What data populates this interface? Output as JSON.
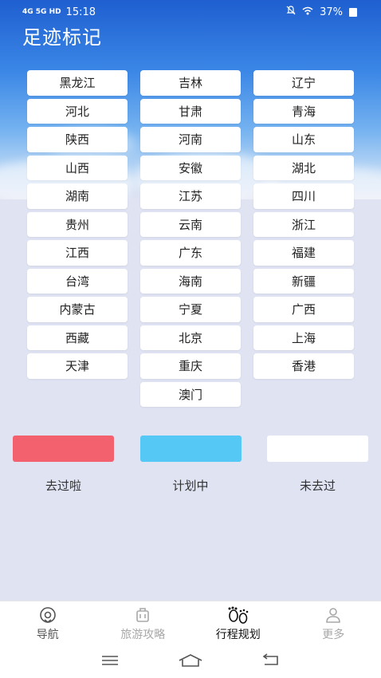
{
  "status_bar": {
    "network": "4G 5G HD",
    "time": "15:18",
    "battery": "37%"
  },
  "title": "足迹标记",
  "provinces": [
    "黑龙江",
    "吉林",
    "辽宁",
    "河北",
    "甘肃",
    "青海",
    "陕西",
    "河南",
    "山东",
    "山西",
    "安徽",
    "湖北",
    "湖南",
    "江苏",
    "四川",
    "贵州",
    "云南",
    "浙江",
    "江西",
    "广东",
    "福建",
    "台湾",
    "海南",
    "新疆",
    "内蒙古",
    "宁夏",
    "广西",
    "西藏",
    "北京",
    "上海",
    "天津",
    "重庆",
    "香港",
    "",
    "澳门",
    ""
  ],
  "legend": [
    {
      "label": "去过啦",
      "color": "#f2616d"
    },
    {
      "label": "计划中",
      "color": "#55c8f5"
    },
    {
      "label": "未去过",
      "color": "#ffffff"
    }
  ],
  "nav": [
    {
      "label": "导航",
      "icon": "compass-icon",
      "active": false
    },
    {
      "label": "旅游攻略",
      "icon": "luggage-icon",
      "active": false
    },
    {
      "label": "行程规划",
      "icon": "footprint-icon",
      "active": true
    },
    {
      "label": "更多",
      "icon": "person-icon",
      "active": false
    }
  ],
  "colors": {
    "active": "#111111",
    "inactive": "#a8a8a8",
    "nav_dim": "#555555"
  }
}
